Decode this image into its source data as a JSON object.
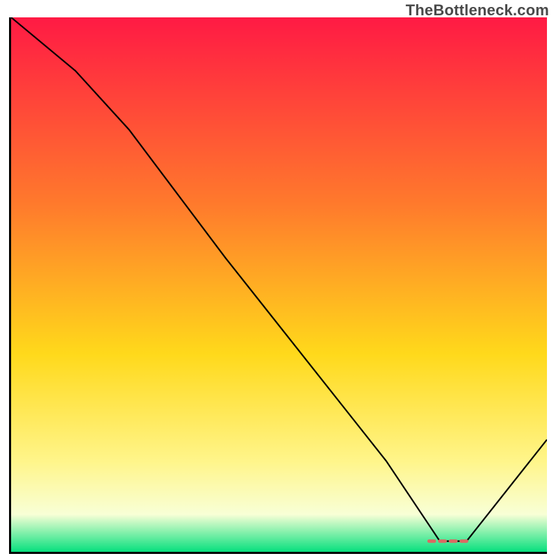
{
  "watermark": "TheBottleneck.com",
  "colors": {
    "gradient_top": "#ff1a44",
    "gradient_mid1": "#ff7a2c",
    "gradient_mid2": "#ffd91b",
    "gradient_mid3": "#fff58a",
    "gradient_mid4": "#f8ffd6",
    "gradient_bottom": "#07e07e",
    "axis": "#000000",
    "curve": "#000000",
    "marker": "#d96b63"
  },
  "chart_data": {
    "type": "line",
    "title": "",
    "xlabel": "",
    "ylabel": "",
    "xlim": [
      0,
      100
    ],
    "ylim": [
      0,
      100
    ],
    "series": [
      {
        "name": "bottleneck-curve",
        "x": [
          0,
          12,
          22,
          40,
          55,
          70,
          80,
          85,
          100
        ],
        "values": [
          100,
          90,
          79,
          55,
          36,
          17,
          2,
          2,
          21
        ]
      }
    ],
    "annotations": [
      {
        "name": "optimum-marker",
        "x_range": [
          78,
          86
        ],
        "y": 2
      }
    ]
  }
}
